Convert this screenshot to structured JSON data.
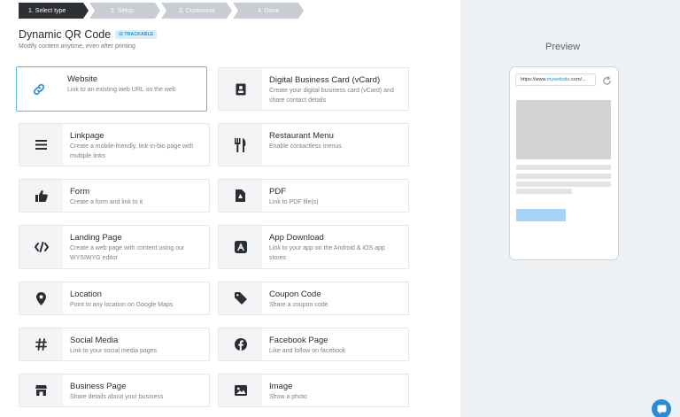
{
  "stepper": {
    "steps": [
      "1. Select type",
      "2. Setup",
      "3. Customize",
      "4. Done"
    ]
  },
  "header": {
    "title": "Dynamic QR Code",
    "badge": "TRACKABLE",
    "subtitle": "Modify content anytime, even after printing"
  },
  "types": [
    {
      "name": "Website",
      "desc": "Link to an existing web URL on the web",
      "icon": "link-icon"
    },
    {
      "name": "Digital Business Card (vCard)",
      "desc": "Create your digital business card (vCard) and share contact details",
      "icon": "contact-card-icon"
    },
    {
      "name": "Linkpage",
      "desc": "Create a mobile-friendly, link-in-bio page with multiple links",
      "icon": "menu-lines-icon"
    },
    {
      "name": "Restaurant Menu",
      "desc": "Enable contactless menus",
      "icon": "fork-knife-icon"
    },
    {
      "name": "Form",
      "desc": "Create a form and link to it",
      "icon": "thumbs-up-icon"
    },
    {
      "name": "PDF",
      "desc": "Link to PDF file(s)",
      "icon": "pdf-file-icon"
    },
    {
      "name": "Landing Page",
      "desc": "Create a web page with content using our WYSIWYG editor",
      "icon": "code-icon"
    },
    {
      "name": "App Download",
      "desc": "Link to your app on the Android & iOS app stores",
      "icon": "app-store-icon"
    },
    {
      "name": "Location",
      "desc": "Point to any location on Google Maps",
      "icon": "location-pin-icon"
    },
    {
      "name": "Coupon Code",
      "desc": "Share a coupon code",
      "icon": "tag-icon"
    },
    {
      "name": "Social Media",
      "desc": "Link to your social media pages",
      "icon": "hashtag-icon"
    },
    {
      "name": "Facebook Page",
      "desc": "Like and follow on facebook",
      "icon": "facebook-icon"
    },
    {
      "name": "Business Page",
      "desc": "Share details about your business",
      "icon": "store-icon"
    },
    {
      "name": "Image",
      "desc": "Show a photo",
      "icon": "image-icon"
    }
  ],
  "preview": {
    "label": "Preview",
    "url_prefix": "https://www.",
    "url_highlight": "mywebsite",
    "url_suffix": ".com/..."
  },
  "colors": {
    "accent": "#2a8bd6",
    "selected_border": "#56b7ea",
    "step_active": "#2c2f33",
    "step_inactive": "#c7cdd3"
  }
}
